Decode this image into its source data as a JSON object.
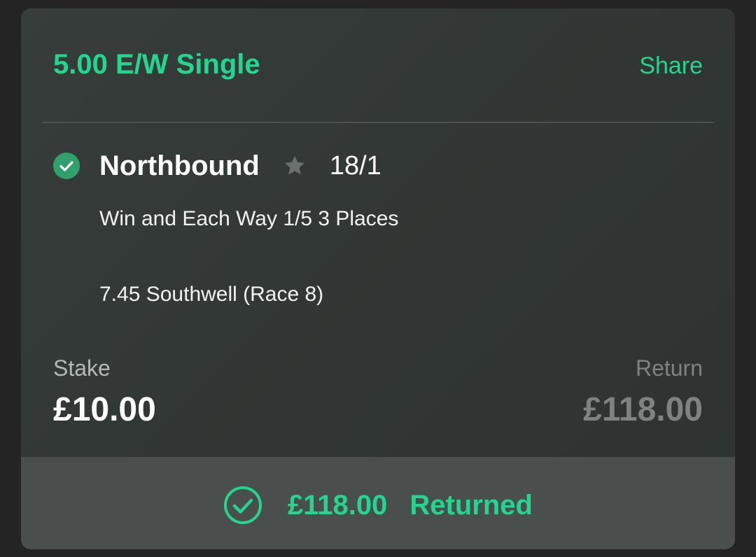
{
  "bet": {
    "title": "5.00 E/W Single",
    "share_label": "Share"
  },
  "selection": {
    "status_icon": "check-circle-icon",
    "name": "Northbound",
    "favourite_icon": "star-icon",
    "odds": "18/1",
    "market": "Win and Each Way 1/5 3 Places",
    "event": "7.45 Southwell (Race 8)"
  },
  "stake": {
    "label": "Stake",
    "value": "£10.00"
  },
  "return": {
    "label": "Return",
    "value": "£118.00"
  },
  "footer": {
    "icon": "check-circle-outline-icon",
    "amount": "£118.00",
    "status": "Returned"
  },
  "colors": {
    "accent": "#22d68f",
    "check_fill": "#2fa16d",
    "card_bg": "#333936",
    "footer_bg": "#4a4f4d",
    "muted": "#7e8381"
  }
}
